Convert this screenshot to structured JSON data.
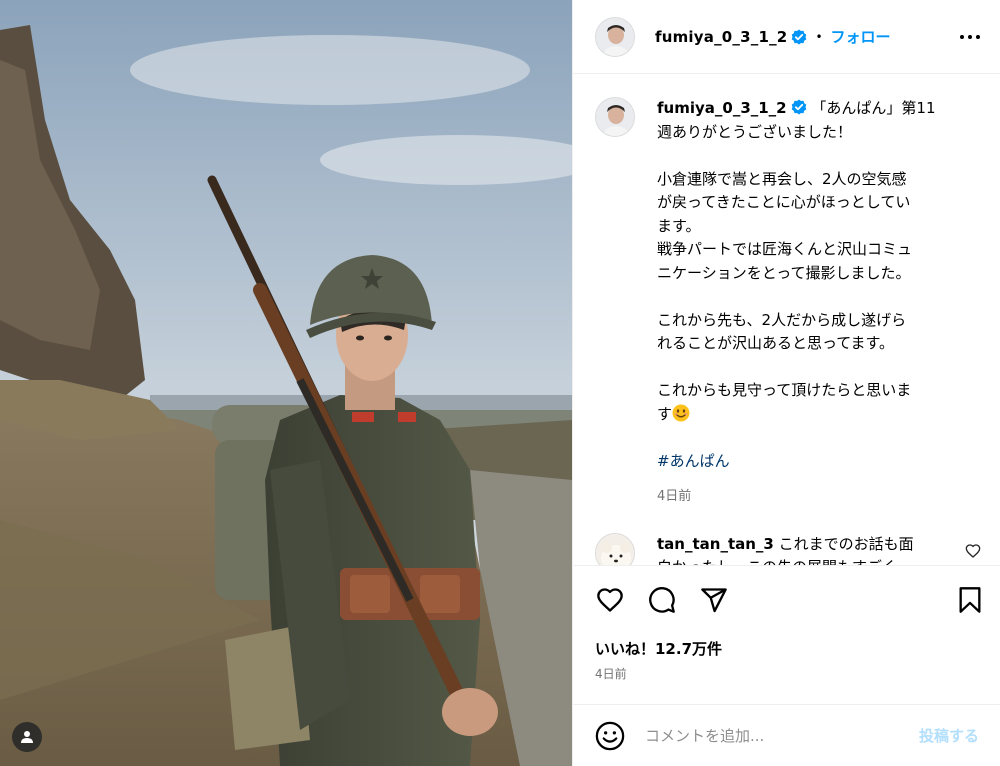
{
  "post": {
    "username": "fumiya_0_3_1_2",
    "follow_label": "フォロー",
    "caption_lines": [
      "「あんぱん」第11",
      "週ありがとうございました！",
      "",
      "小倉連隊で嵩と再会し、2人の空気感",
      "が戻ってきたことに心がほっとしてい",
      "ます。",
      "戦争パートでは匠海くんと沢山コミュ",
      "ニケーションをとって撮影しました。",
      "",
      "これから先も、2人だから成し遂げら",
      "れることが沢山あると思ってます。",
      "",
      "これからも見守って頂けたらと思いま",
      "す"
    ],
    "hashtag": "#あんぱん",
    "caption_time": "4日前",
    "likes": "いいね！12.7万件",
    "date": "4日前"
  },
  "comment": {
    "username": "tan_tan_tan_3",
    "lines": [
      "これまでのお話も面",
      "白かったし、この先の展開もすごく"
    ]
  },
  "composer": {
    "placeholder": "コメントを追加...",
    "post_label": "投稿する"
  },
  "colors": {
    "accent": "#0095f6",
    "hashtag": "#00376b",
    "muted": "#737373",
    "post_disabled": "#b2dffc"
  },
  "icons": [
    "verified-badge-icon",
    "more-options-icon",
    "heart-icon",
    "comment-icon",
    "share-icon",
    "bookmark-icon",
    "emoji-icon",
    "user-tag-icon"
  ]
}
